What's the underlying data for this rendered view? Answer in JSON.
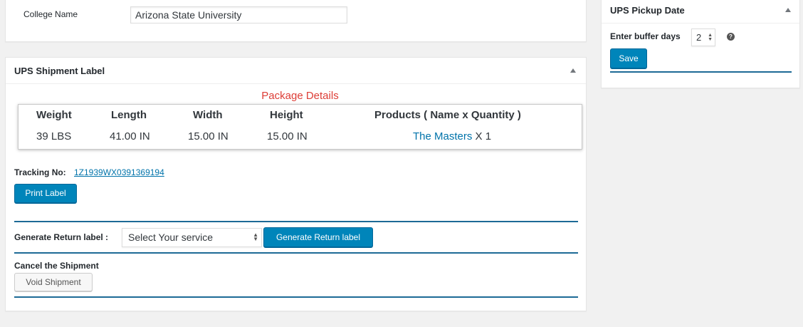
{
  "college": {
    "label": "College Name",
    "value": "Arizona State University"
  },
  "shipment": {
    "title": "UPS Shipment Label",
    "package_heading": "Package Details",
    "columns": [
      "Weight",
      "Length",
      "Width",
      "Height",
      "Products ( Name x Quantity )"
    ],
    "row": {
      "weight": "39 LBS",
      "length": "41.00 IN",
      "width": "15.00 IN",
      "height": "15.00 IN",
      "product_name": "The Masters",
      "product_qty": "X 1"
    },
    "tracking_label": "Tracking No:",
    "tracking_number": "1Z1939WX0391369194",
    "print_label": "Print Label",
    "return_label": "Generate Return label :",
    "service_select_value": "Select Your service",
    "generate_return_button": "Generate Return label",
    "cancel_label": "Cancel the Shipment",
    "void_button": "Void Shipment"
  },
  "pickup": {
    "title": "UPS Pickup Date",
    "buffer_label": "Enter buffer days",
    "buffer_value": "2",
    "help_icon": "?",
    "save_button": "Save"
  },
  "colors": {
    "primary_button": "#0085ba",
    "link": "#0073aa",
    "heading_red": "#dd3d36",
    "divider": "#1d6a96"
  }
}
